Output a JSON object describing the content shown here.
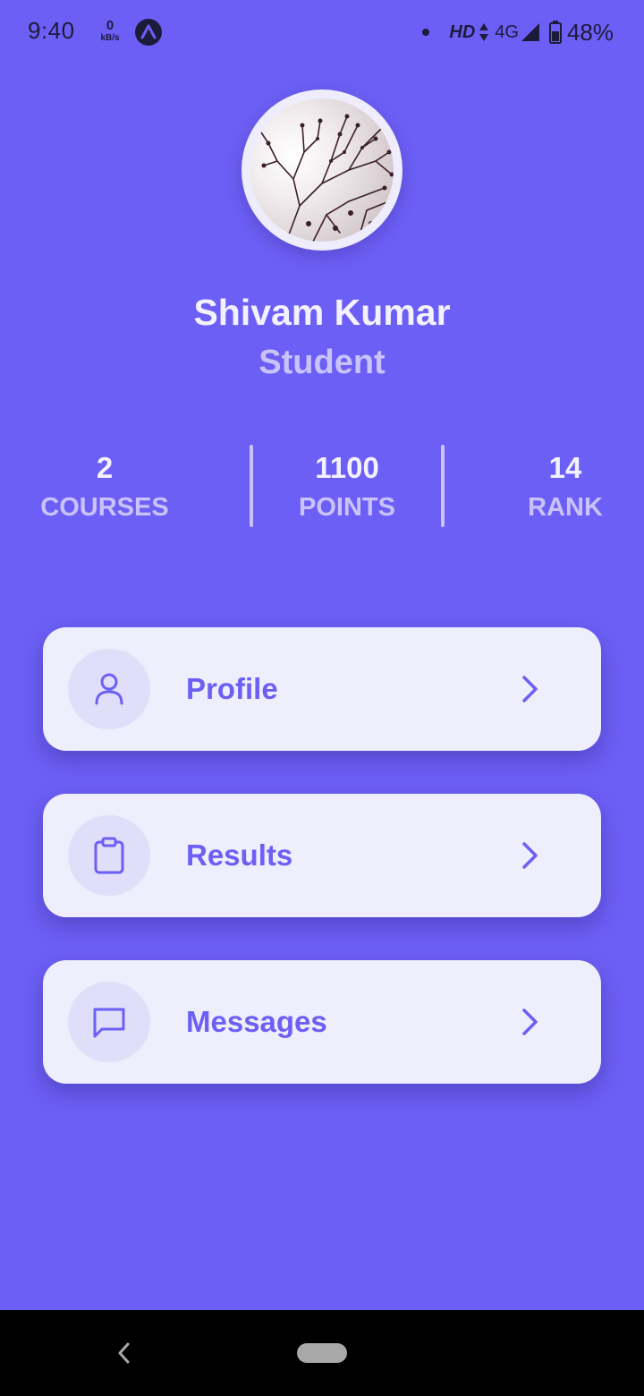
{
  "status_bar": {
    "time": "9:40",
    "net_speed_value": "0",
    "net_speed_unit": "kB/s",
    "hd_label": "HD",
    "network_type": "4G",
    "battery_percent": "48%"
  },
  "profile": {
    "name": "Shivam Kumar",
    "role": "Student"
  },
  "stats": [
    {
      "value": "2",
      "label": "COURSES"
    },
    {
      "value": "1100",
      "label": "POINTS"
    },
    {
      "value": "14",
      "label": "RANK"
    }
  ],
  "menu": [
    {
      "label": "Profile",
      "icon": "user-icon"
    },
    {
      "label": "Results",
      "icon": "clipboard-icon"
    },
    {
      "label": "Messages",
      "icon": "message-icon"
    }
  ],
  "colors": {
    "background": "#6C5FF5",
    "card": "#EFEEFC",
    "accent": "#6C5FF5",
    "muted_text": "#C9C3FA"
  }
}
